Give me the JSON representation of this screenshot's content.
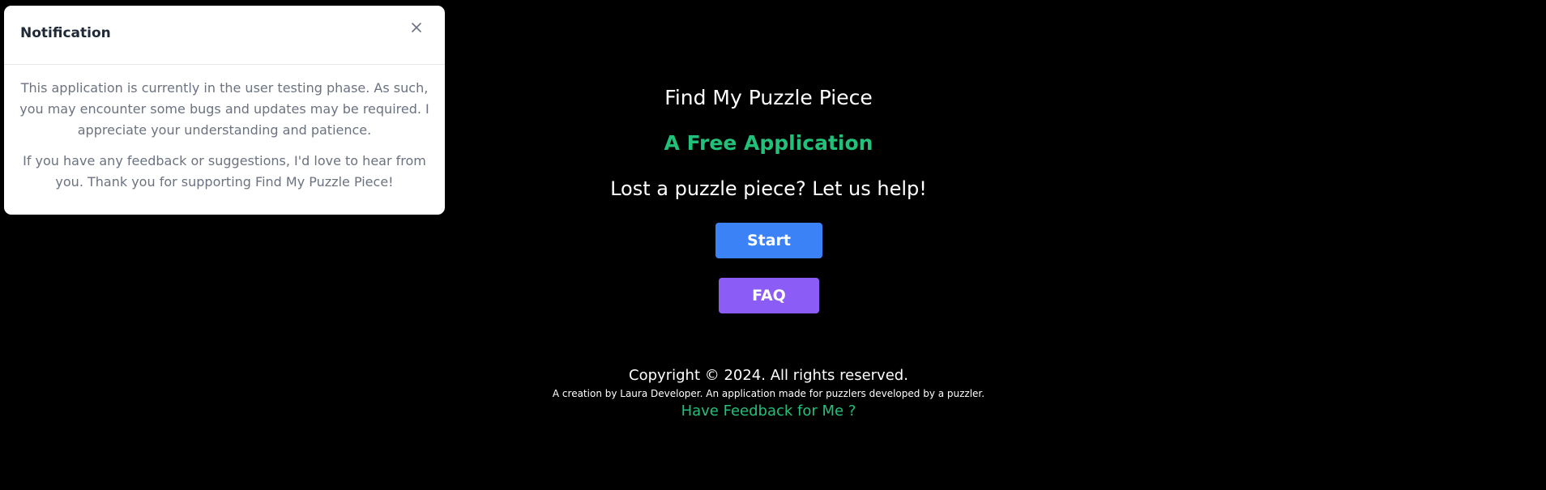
{
  "notification": {
    "title": "Notification",
    "close_icon": "close-icon",
    "paragraph_1": "This application is currently in the user testing phase. As such, you may encounter some bugs and updates may be required. I appreciate your understanding and patience.",
    "paragraph_2": "If you have any feedback or suggestions, I'd love to hear from you. Thank you for supporting Find My Puzzle Piece!"
  },
  "main": {
    "app_name": "Find My Puzzle Piece",
    "tagline": "A Free Application",
    "help_line": "Lost a puzzle piece? Let us help!",
    "start_label": "Start",
    "faq_label": "FAQ"
  },
  "footer": {
    "copyright": "Copyright © 2024. All rights reserved.",
    "credit": "A creation by Laura Developer. An application made for puzzlers developed by a puzzler.",
    "feedback_link": "Have Feedback for Me ?"
  },
  "colors": {
    "background": "#000000",
    "accent_green": "#22c17a",
    "start_button": "#3b82f6",
    "faq_button": "#8b5cf6"
  }
}
